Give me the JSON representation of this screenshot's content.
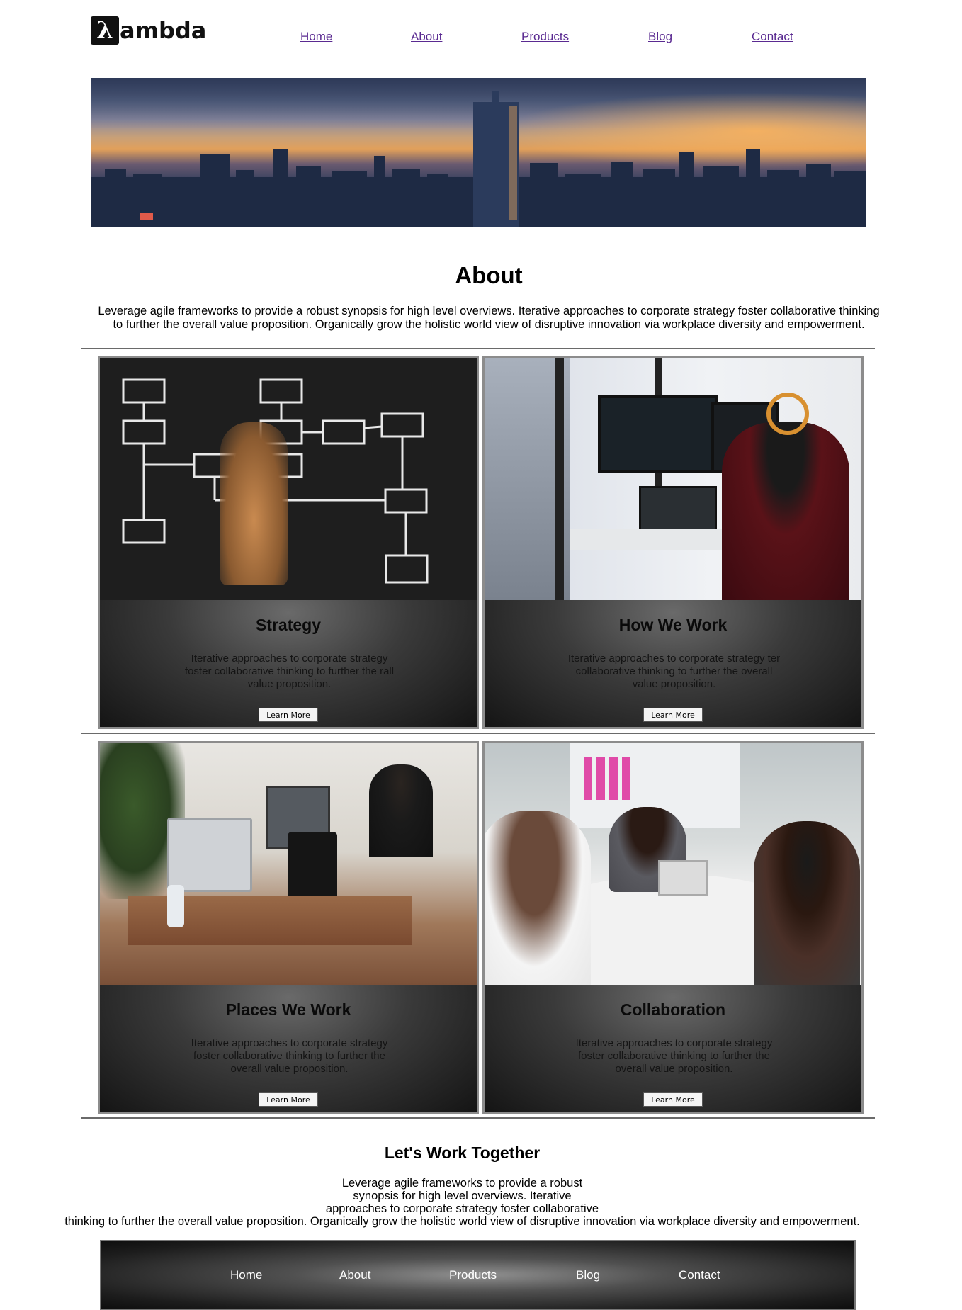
{
  "header": {
    "logo_mark": "λ",
    "logo_text": "ambda",
    "nav": [
      "Home",
      "About",
      "Products",
      "Blog",
      "Contact"
    ]
  },
  "about": {
    "title": "About",
    "text": "Leverage agile frameworks to provide a robust synopsis for high level overviews. Iterative approaches to corporate strategy foster collaborative thinking to further the overall value proposition. Organically grow the holistic world view of disruptive innovation via workplace diversity and empowerment."
  },
  "cards": [
    {
      "title": "Strategy",
      "text": "Iterative approaches to corporate strategy foster collaborative thinking to further the rall value proposition.",
      "button": "Learn More"
    },
    {
      "title": "How We Work",
      "text": "Iterative approaches to corporate strategy ter collaborative thinking to further the overall value proposition.",
      "button": "Learn More"
    },
    {
      "title": "Places We Work",
      "text": "Iterative approaches to corporate strategy foster collaborative thinking to further the overall value proposition.",
      "button": "Learn More"
    },
    {
      "title": "Collaboration",
      "text": "Iterative approaches to corporate strategy foster collaborative thinking to further the overall value proposition.",
      "button": "Learn More"
    }
  ],
  "together": {
    "title": "Let's Work Together",
    "lines": [
      "Leverage agile frameworks to provide a robust",
      "synopsis for high level overviews. Iterative",
      "approaches to corporate strategy foster collaborative",
      "thinking to further the overall value proposition. Organically grow the holistic world view of disruptive innovation via workplace diversity and empowerment."
    ]
  },
  "footer": {
    "nav": [
      "Home",
      "About",
      "Products",
      "Blog",
      "Contact"
    ]
  },
  "colors": {
    "nav_link": "#5a2a91",
    "footer_link": "#ffffff",
    "card_border": "#8c8c8c"
  }
}
